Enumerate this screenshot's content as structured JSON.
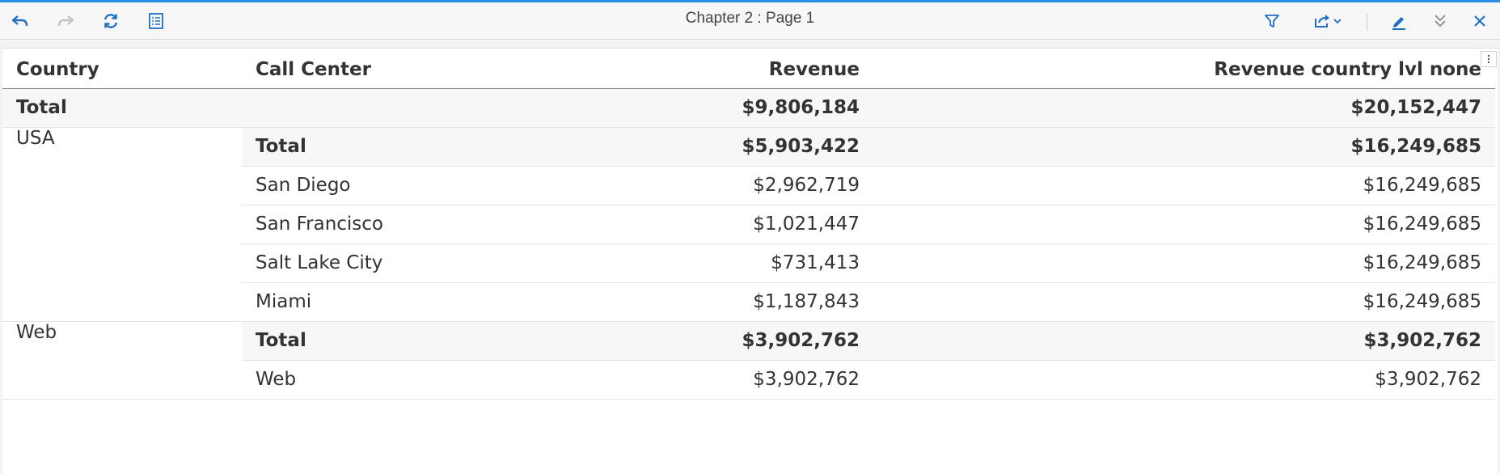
{
  "toolbar": {
    "title": "Chapter 2 : Page 1",
    "icons": {
      "undo": "undo-icon",
      "redo": "redo-icon",
      "refresh": "refresh-icon",
      "outline": "outline-icon",
      "filter": "filter-icon",
      "share": "share-icon",
      "edit": "edit-icon",
      "collapse": "collapse-icon",
      "close": "close-icon"
    },
    "accent_color": "#2b8fe6"
  },
  "table": {
    "headers": {
      "country": "Country",
      "call_center": "Call Center",
      "revenue": "Revenue",
      "revenue_country": "Revenue country lvl none"
    },
    "grand_total": {
      "label": "Total",
      "revenue": "$9,806,184",
      "revenue_country": "$20,152,447"
    },
    "groups": [
      {
        "country": "USA",
        "rows": [
          {
            "call_center": "Total",
            "revenue": "$5,903,422",
            "revenue_country": "$16,249,685"
          },
          {
            "call_center": "San Diego",
            "revenue": "$2,962,719",
            "revenue_country": "$16,249,685"
          },
          {
            "call_center": "San Francisco",
            "revenue": "$1,021,447",
            "revenue_country": "$16,249,685"
          },
          {
            "call_center": "Salt Lake City",
            "revenue": "$731,413",
            "revenue_country": "$16,249,685"
          },
          {
            "call_center": "Miami",
            "revenue": "$1,187,843",
            "revenue_country": "$16,249,685"
          }
        ]
      },
      {
        "country": "Web",
        "rows": [
          {
            "call_center": "Total",
            "revenue": "$3,902,762",
            "revenue_country": "$3,902,762"
          },
          {
            "call_center": "Web",
            "revenue": "$3,902,762",
            "revenue_country": "$3,902,762"
          }
        ]
      }
    ]
  }
}
